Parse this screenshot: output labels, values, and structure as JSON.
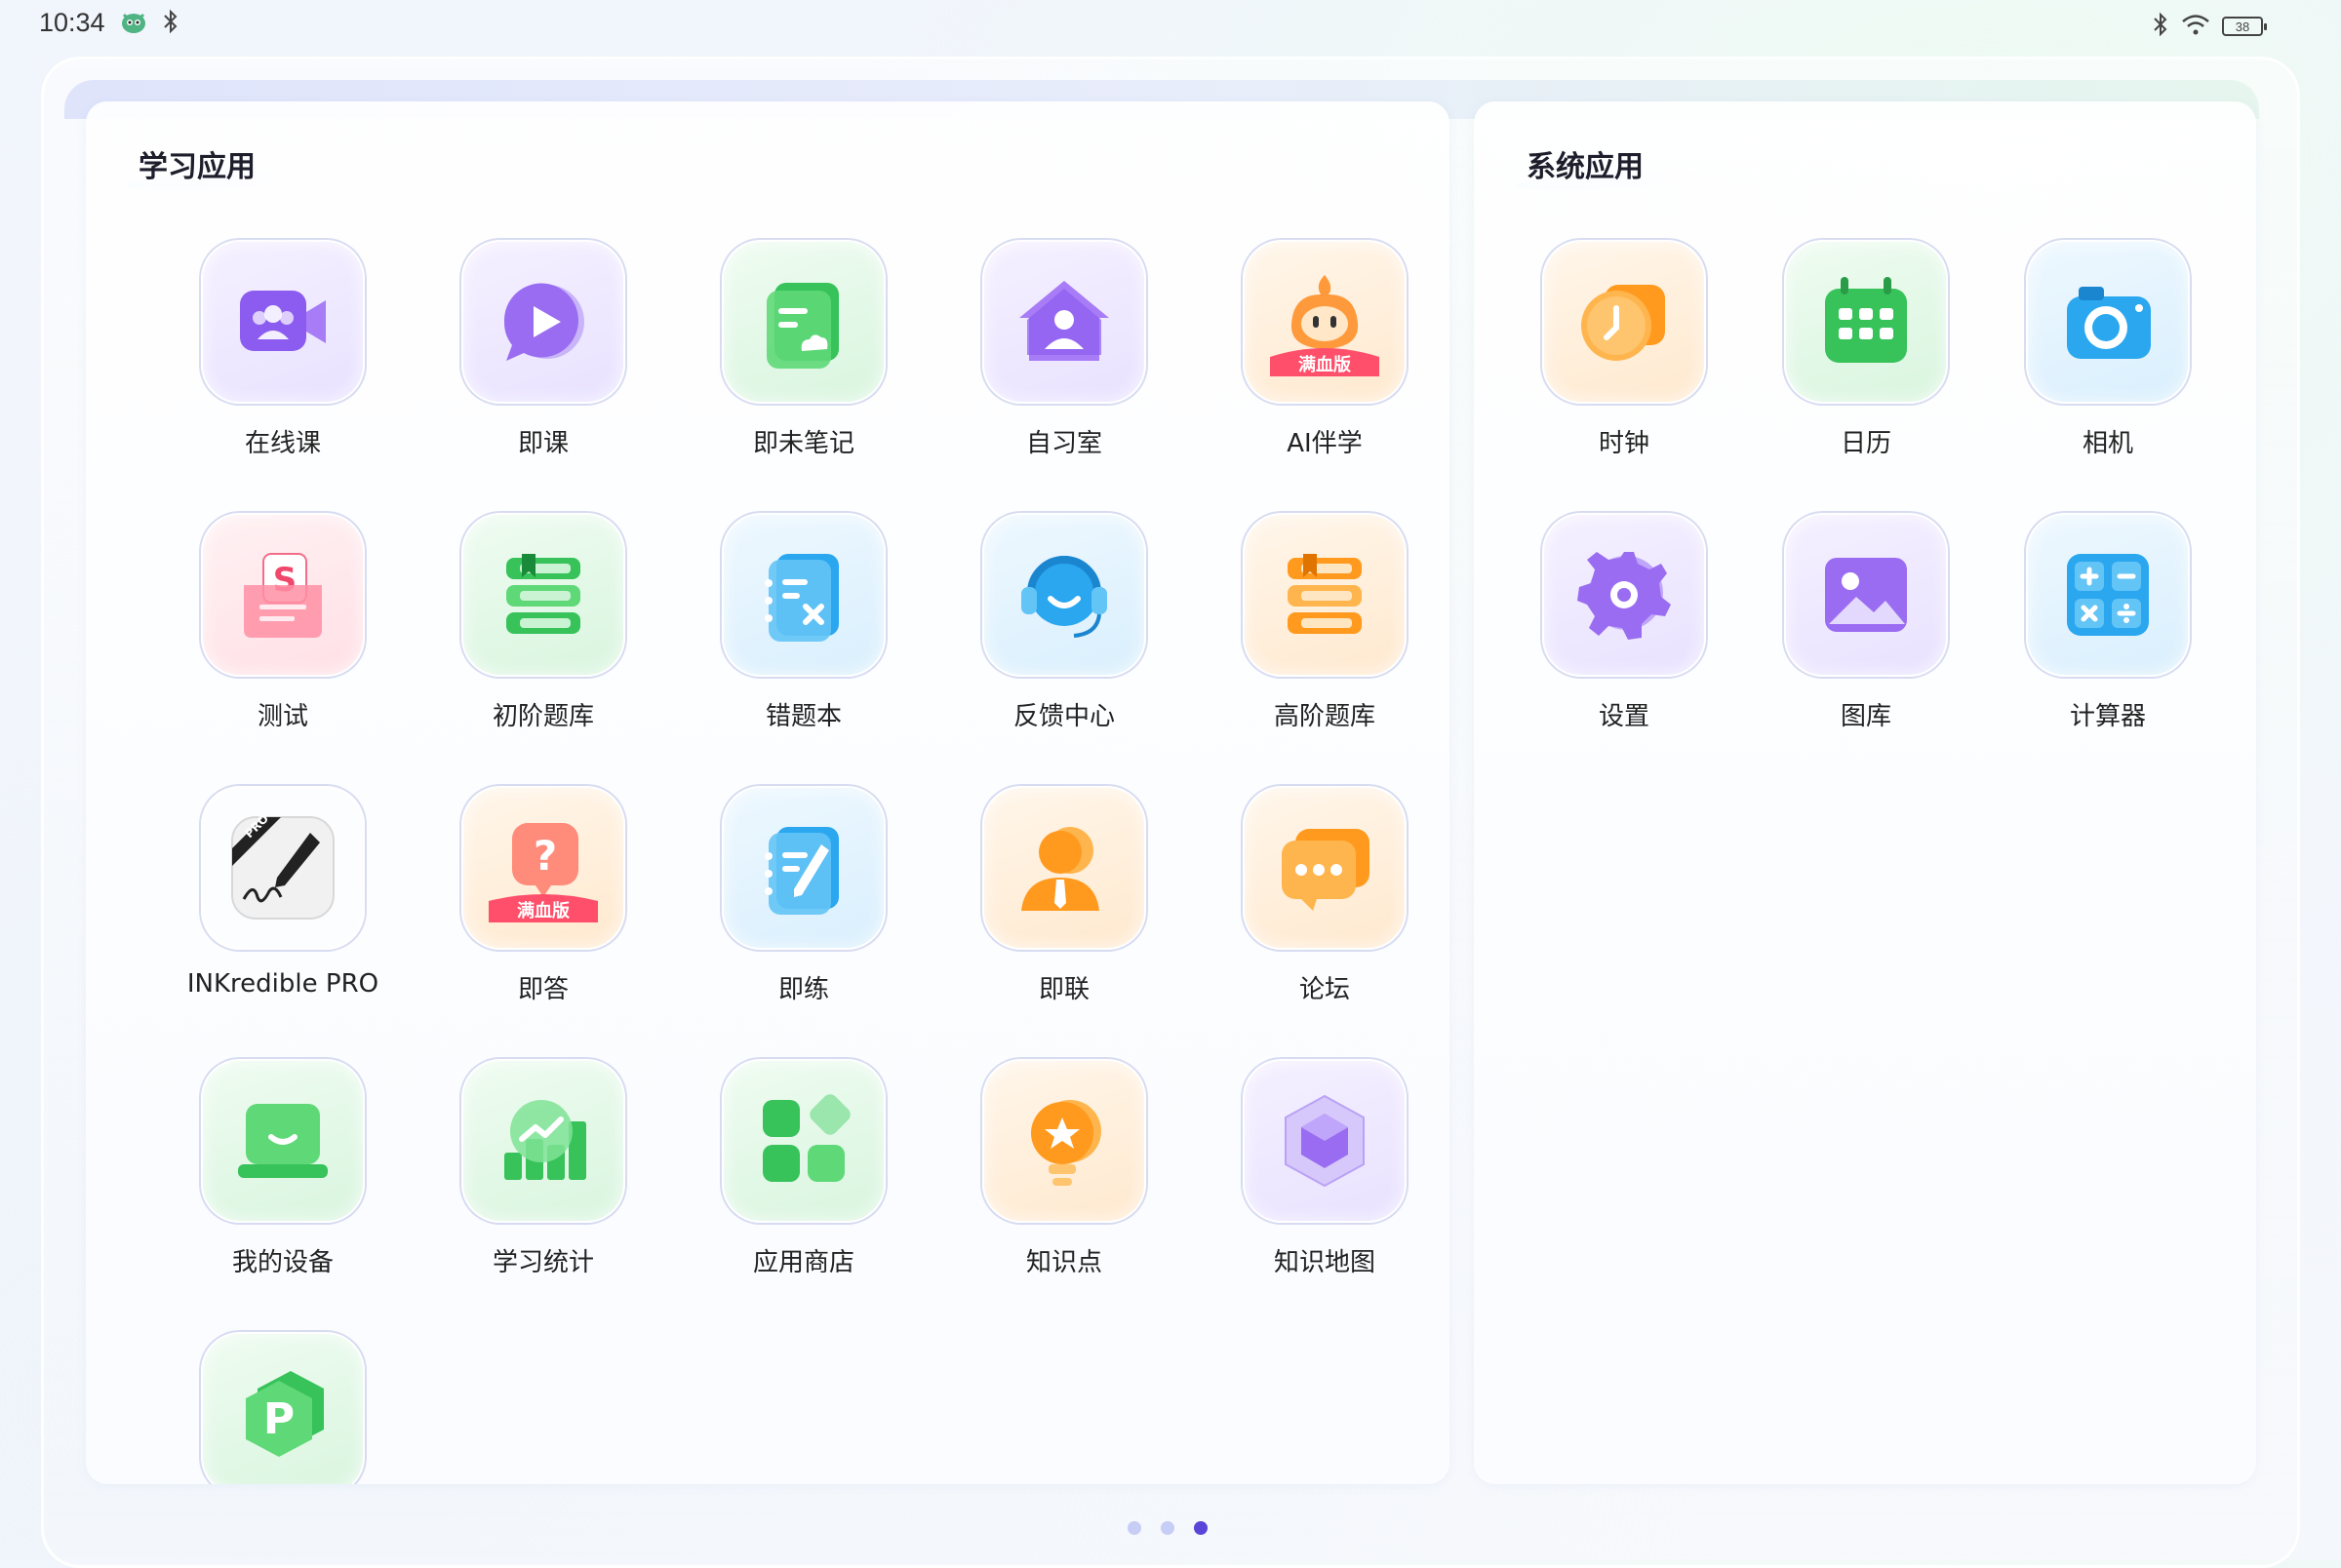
{
  "status_bar": {
    "time": "10:34",
    "battery_level": "38",
    "icons": [
      "mascot-icon",
      "bluetooth-icon",
      "wifi-icon",
      "battery-icon"
    ]
  },
  "study_apps": {
    "title": "学习应用",
    "apps": [
      {
        "label": "在线课",
        "icon": "video-class-icon",
        "theme": "purple"
      },
      {
        "label": "即课",
        "icon": "play-bubble-icon",
        "theme": "purple"
      },
      {
        "label": "即未笔记",
        "icon": "note-doc-icon",
        "theme": "green"
      },
      {
        "label": "自习室",
        "icon": "study-room-house-icon",
        "theme": "purple"
      },
      {
        "label": "AI伴学",
        "icon": "ai-mascot-icon",
        "theme": "orange",
        "badge": "满血版"
      },
      {
        "label": "测试",
        "icon": "test-envelope-icon",
        "theme": "pink"
      },
      {
        "label": "初阶题库",
        "icon": "book-stack-icon",
        "theme": "green"
      },
      {
        "label": "错题本",
        "icon": "mistake-notebook-icon",
        "theme": "blue"
      },
      {
        "label": "反馈中心",
        "icon": "headset-icon",
        "theme": "blue"
      },
      {
        "label": "高阶题库",
        "icon": "book-stack-icon",
        "theme": "orange"
      },
      {
        "label": "INKredible PRO",
        "icon": "pen-signature-icon",
        "theme": "plain",
        "badge": "PRO"
      },
      {
        "label": "即答",
        "icon": "question-bubble-icon",
        "theme": "orange",
        "badge": "满血版"
      },
      {
        "label": "即练",
        "icon": "practice-notebook-icon",
        "theme": "blue"
      },
      {
        "label": "即联",
        "icon": "person-contact-icon",
        "theme": "orange"
      },
      {
        "label": "论坛",
        "icon": "chat-bubble-icon",
        "theme": "orange"
      },
      {
        "label": "我的设备",
        "icon": "device-laptop-icon",
        "theme": "green"
      },
      {
        "label": "学习统计",
        "icon": "stats-chart-icon",
        "theme": "green"
      },
      {
        "label": "应用商店",
        "icon": "app-store-grid-icon",
        "theme": "green"
      },
      {
        "label": "知识点",
        "icon": "lightbulb-star-icon",
        "theme": "orange"
      },
      {
        "label": "知识地图",
        "icon": "hexagon-cube-icon",
        "theme": "purple"
      },
      {
        "label": "",
        "icon": "p-hexagon-icon",
        "theme": "green"
      }
    ]
  },
  "system_apps": {
    "title": "系统应用",
    "apps": [
      {
        "label": "时钟",
        "icon": "clock-icon",
        "theme": "orange"
      },
      {
        "label": "日历",
        "icon": "calendar-icon",
        "theme": "green"
      },
      {
        "label": "相机",
        "icon": "camera-icon",
        "theme": "blue"
      },
      {
        "label": "设置",
        "icon": "gear-icon",
        "theme": "purple"
      },
      {
        "label": "图库",
        "icon": "gallery-icon",
        "theme": "purple"
      },
      {
        "label": "计算器",
        "icon": "calculator-icon",
        "theme": "blue"
      }
    ]
  },
  "page_indicator": {
    "pages": 3,
    "active": 3
  }
}
